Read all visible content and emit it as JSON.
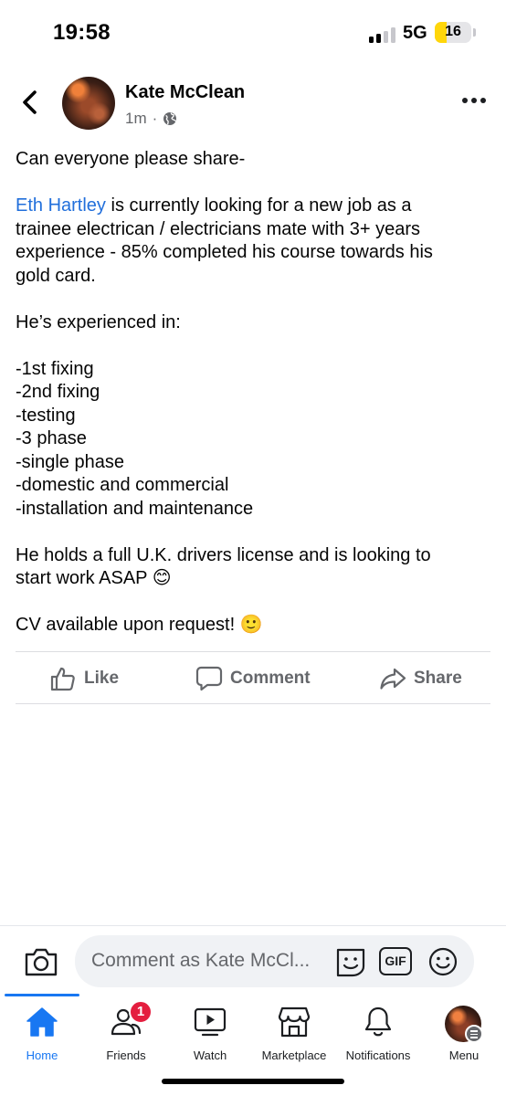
{
  "status_bar": {
    "time": "19:58",
    "network": "5G",
    "battery_level": "16",
    "signal_bars": 2,
    "signal_bars_total": 4
  },
  "post": {
    "author": "Kate McClean",
    "time_ago": "1m",
    "separator": "·",
    "audience_icon": "globe-icon",
    "body_lines": [
      "Can everyone please share-",
      "",
      {
        "mention": "Eth Hartley",
        "text": " is currently looking for a new job as a"
      },
      "trainee electrican / electricians mate with 3+ years",
      "experience - 85% completed his course towards his",
      "gold card.",
      "",
      "He’s experienced in:",
      "",
      "-1st fixing",
      "-2nd fixing",
      "-testing",
      "-3 phase",
      "-single phase",
      "-domestic and commercial",
      "-installation and maintenance",
      "",
      "He holds a full U.K. drivers license and is looking to",
      "start work ASAP 😊",
      "",
      "CV available upon request! 🙂"
    ]
  },
  "actions": {
    "like": "Like",
    "comment": "Comment",
    "share": "Share"
  },
  "composer": {
    "placeholder": "Comment as Kate McCl...",
    "gif_label": "GIF"
  },
  "tabs": [
    {
      "label": "Home",
      "icon": "home-icon",
      "active": true
    },
    {
      "label": "Friends",
      "icon": "friends-icon",
      "badge": "1"
    },
    {
      "label": "Watch",
      "icon": "watch-icon"
    },
    {
      "label": "Marketplace",
      "icon": "marketplace-icon"
    },
    {
      "label": "Notifications",
      "icon": "bell-icon"
    },
    {
      "label": "Menu",
      "icon": "profile-avatar"
    }
  ],
  "colors": {
    "accent": "#1877f2",
    "mention": "#216fdb",
    "badge": "#e41e3f",
    "secondary_text": "#65676b",
    "battery": "#ffd60a"
  }
}
